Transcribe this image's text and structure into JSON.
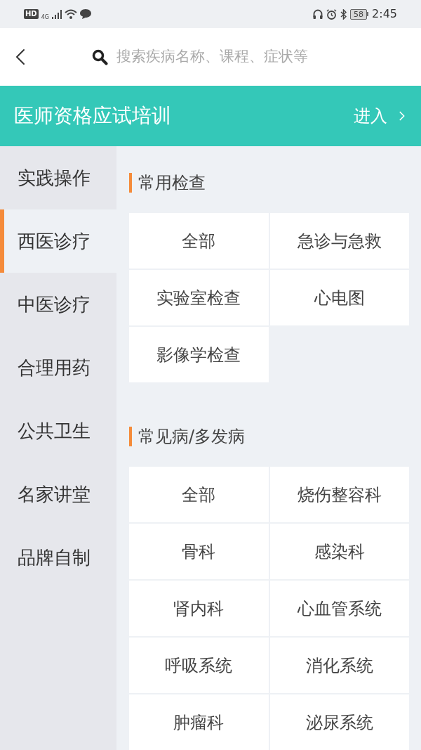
{
  "status_bar": {
    "hd": "HD",
    "network": "4G",
    "battery": "58",
    "time": "2:45"
  },
  "header": {
    "search": {
      "placeholder": "搜索疾病名称、课程、症状等"
    }
  },
  "banner": {
    "title": "医师资格应试培训",
    "action": "进入"
  },
  "sidebar": {
    "items": [
      {
        "label": "实践操作",
        "selected": false
      },
      {
        "label": "西医诊疗",
        "selected": true
      },
      {
        "label": "中医诊疗",
        "selected": false
      },
      {
        "label": "合理用药",
        "selected": false
      },
      {
        "label": "公共卫生",
        "selected": false
      },
      {
        "label": "名家讲堂",
        "selected": false
      },
      {
        "label": "品牌自制",
        "selected": false
      }
    ]
  },
  "sections": [
    {
      "title": "常用检查",
      "items": [
        "全部",
        "急诊与急救",
        "实验室检查",
        "心电图",
        "影像学检查"
      ]
    },
    {
      "title": "常见病/多发病",
      "items": [
        "全部",
        "烧伤整容科",
        "骨科",
        "感染科",
        "肾内科",
        "心血管系统",
        "呼吸系统",
        "消化系统",
        "肿瘤科",
        "泌尿系统"
      ]
    }
  ]
}
